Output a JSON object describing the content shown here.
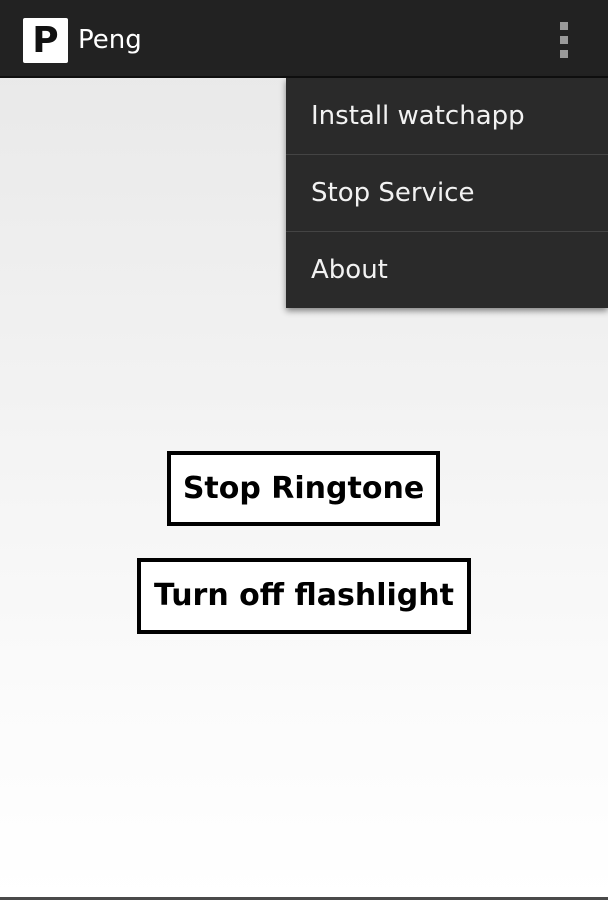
{
  "app": {
    "title": "Peng",
    "icon_letter": "P",
    "icon": "app-logo-icon"
  },
  "action_bar": {
    "overflow_icon": "overflow-menu-icon"
  },
  "menu": {
    "items": [
      {
        "label": "Install watchapp"
      },
      {
        "label": "Stop Service"
      },
      {
        "label": "About"
      }
    ]
  },
  "buttons": {
    "stop_ringtone": "Stop Ringtone",
    "turn_off_flashlight": "Turn off flashlight"
  },
  "colors": {
    "action_bar": "#222222",
    "menu_background": "#2a2a2a",
    "menu_text": "#f2f2f2",
    "button_border": "#000000"
  }
}
